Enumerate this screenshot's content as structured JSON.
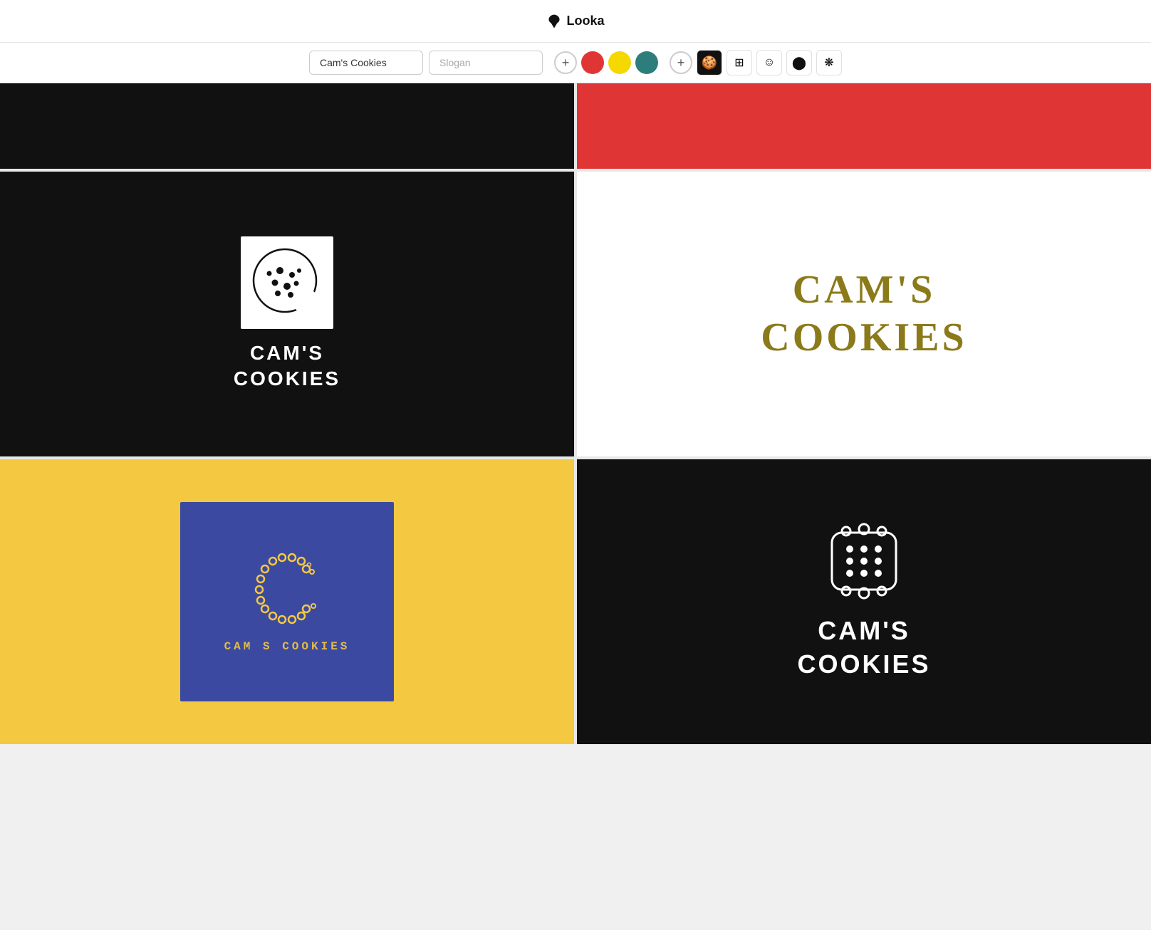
{
  "header": {
    "logo_text": "Looka"
  },
  "toolbar": {
    "brand_name": "Cam's Cookies",
    "brand_name_placeholder": "Cam's Cookies",
    "slogan_placeholder": "Slogan",
    "plus_label_colors": "+",
    "plus_label_icons": "+",
    "colors": [
      {
        "name": "red",
        "hex": "#e03535"
      },
      {
        "name": "yellow",
        "hex": "#f5d800"
      },
      {
        "name": "teal",
        "hex": "#2d7d7d"
      }
    ],
    "icons": [
      {
        "name": "cookie-crescent",
        "symbol": "🌑"
      },
      {
        "name": "waffle-grid",
        "symbol": "⊞"
      },
      {
        "name": "cookie-circle",
        "symbol": "☺"
      },
      {
        "name": "circle-dots",
        "symbol": "⬤"
      },
      {
        "name": "flower-gear",
        "symbol": "❋"
      }
    ]
  },
  "cards": [
    {
      "id": "card-1",
      "bg": "#111111",
      "type": "partial-top-left"
    },
    {
      "id": "card-2",
      "bg": "#e03535",
      "type": "partial-top-right"
    },
    {
      "id": "card-3",
      "bg": "#111111",
      "type": "cookie-box-white",
      "brand_line1": "CAM'S",
      "brand_line2": "COOKIES"
    },
    {
      "id": "card-4",
      "bg": "#ffffff",
      "type": "text-only-gold",
      "brand_line1": "CAM'S",
      "brand_line2": "COOKIES",
      "color": "#8b7a1a"
    },
    {
      "id": "card-5",
      "bg": "#f5c842",
      "type": "bubble-c",
      "brand_text": "CAM S COOKIES",
      "box_bg": "#3b4aa0"
    },
    {
      "id": "card-6",
      "bg": "#111111",
      "type": "waffle-icon",
      "brand_line1": "CAM'S",
      "brand_line2": "COOKIES"
    }
  ]
}
